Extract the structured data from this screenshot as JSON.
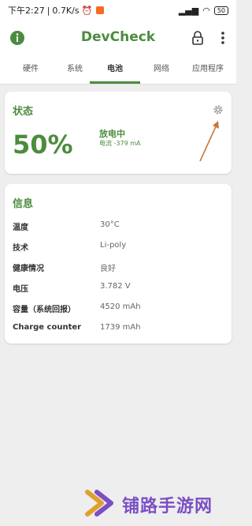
{
  "status_bar": {
    "time": "下午2:27",
    "net_speed": "0.7K/s",
    "battery": "50"
  },
  "app": {
    "title": "DevCheck"
  },
  "tabs": [
    {
      "label": "硬件"
    },
    {
      "label": "系统"
    },
    {
      "label": "电池",
      "active": true
    },
    {
      "label": "网络"
    },
    {
      "label": "应用程序"
    }
  ],
  "status_card": {
    "title": "状态",
    "percent": "50%",
    "state": "放电中",
    "current": "电流 -379 mA"
  },
  "info_card": {
    "title": "信息",
    "rows": [
      {
        "label": "温度",
        "value": "30°C"
      },
      {
        "label": "技术",
        "value": "Li-poly"
      },
      {
        "label": "健康情况",
        "value": "良好"
      },
      {
        "label": "电压",
        "value": "3.782 V"
      },
      {
        "label": "容量（系统回报）",
        "value": "4520 mAh"
      },
      {
        "label": "Charge counter",
        "value": "1739 mAh"
      }
    ]
  },
  "watermark": {
    "text": "铺路手游网"
  },
  "colors": {
    "accent": "#4c8c3e",
    "arrow": "#c8763a",
    "watermark": "#7a4fc4"
  }
}
